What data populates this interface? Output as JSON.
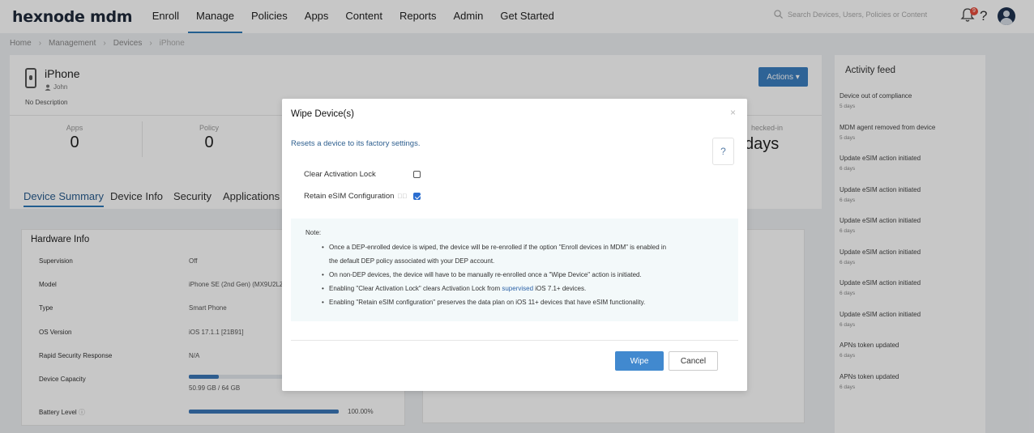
{
  "nav": {
    "logo": "hexnode mdm",
    "links": [
      "Enroll",
      "Manage",
      "Policies",
      "Apps",
      "Content",
      "Reports",
      "Admin",
      "Get Started"
    ],
    "search_placeholder": "Search Devices, Users, Policies or Content",
    "notification_count": "9",
    "help": "?"
  },
  "breadcrumb": [
    "Home",
    "Management",
    "Devices",
    "iPhone"
  ],
  "device": {
    "name": "iPhone",
    "user": "John",
    "description": "No Description",
    "actions_label": "Actions"
  },
  "stats": [
    {
      "label": "Apps",
      "value": "0"
    },
    {
      "label": "Policy",
      "value": "0"
    }
  ],
  "last_checkin": {
    "label": "hecked-in",
    "value": "days"
  },
  "tabs": [
    "Device Summary",
    "Device Info",
    "Security",
    "Applications"
  ],
  "hardware": {
    "title": "Hardware Info",
    "rows": [
      {
        "label": "Supervision",
        "value": "Off"
      },
      {
        "label": "Model",
        "value": "iPhone SE (2nd Gen) (MX9U2LZ"
      },
      {
        "label": "Type",
        "value": "Smart Phone"
      },
      {
        "label": "OS Version",
        "value": "iOS 17.1.1 [21B91]"
      },
      {
        "label": "Rapid Security Response",
        "value": "N/A"
      },
      {
        "label": "Device Capacity",
        "value": "50.99 GB / 64 GB"
      },
      {
        "label": "Battery Level",
        "value": "100.00%"
      }
    ],
    "capacity_used_fraction": 0.2,
    "battery_fraction": 1.0
  },
  "activity_feed": {
    "title": "Activity feed",
    "items": [
      {
        "text": "Device out of compliance",
        "time": "5 days"
      },
      {
        "text": "MDM agent removed from device",
        "time": "5 days"
      },
      {
        "text": "Update eSIM action initiated",
        "time": "6 days"
      },
      {
        "text": "Update eSIM action initiated",
        "time": "6 days"
      },
      {
        "text": "Update eSIM action initiated",
        "time": "6 days"
      },
      {
        "text": "Update eSIM action initiated",
        "time": "6 days"
      },
      {
        "text": "Update eSIM action initiated",
        "time": "6 days"
      },
      {
        "text": "Update eSIM action initiated",
        "time": "6 days"
      },
      {
        "text": "APNs token updated",
        "time": "6 days"
      },
      {
        "text": "APNs token updated",
        "time": "6 days"
      }
    ]
  },
  "modal": {
    "title": "Wipe Device(s)",
    "close": "×",
    "subtitle": "Resets a device to its factory settings.",
    "help": "?",
    "options": [
      {
        "label": "Clear Activation Lock",
        "checked": false
      },
      {
        "label": "Retain eSIM Configuration",
        "checked": true
      }
    ],
    "note_heading": "Note:",
    "notes": [
      "Once a DEP-enrolled device is wiped, the device will be re-enrolled if the option \"Enroll devices in MDM\" is enabled in",
      "the default DEP policy associated with your DEP account.",
      "On non-DEP devices, the device will have to be manually re-enrolled once a \"Wipe Device\" action is initiated."
    ],
    "note_activation_prefix": "Enabling \"Clear Activation Lock\" clears Activation Lock from ",
    "note_activation_link": "supervised",
    "note_activation_suffix": " iOS 7.1+ devices.",
    "note_esim": "Enabling \"Retain eSIM configuration\" preserves the data plan on iOS 11+ devices that have eSIM functionality.",
    "wipe_label": "Wipe",
    "cancel_label": "Cancel"
  },
  "colors": {
    "accent": "#2e79b8",
    "primary_button": "#4189cf",
    "annotation_arrow": "#e8262a"
  }
}
